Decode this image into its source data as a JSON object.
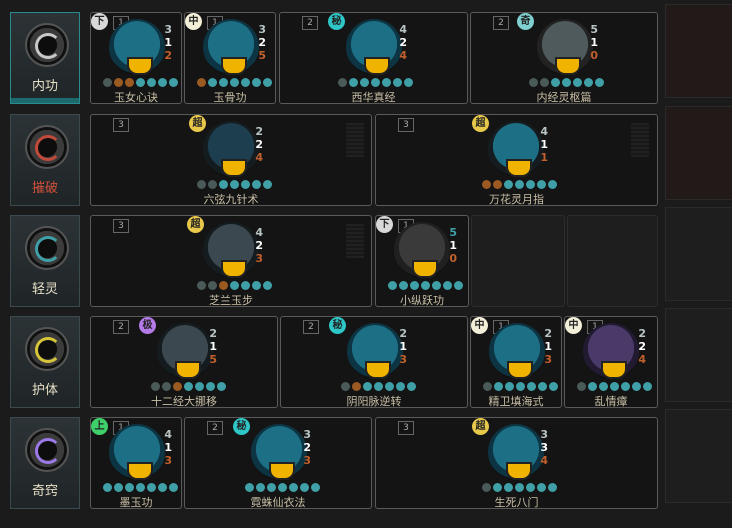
{
  "grade_colors": {
    "下": "#d8d8d8",
    "中": "#f3eed8",
    "秘": "#2ec6c6",
    "奇": "#7fd0d0",
    "超": "#e8c84a",
    "极": "#b47ae8",
    "上": "#3fcf6a"
  },
  "rows": [
    {
      "category": "内功",
      "emblem_color": "#c8c8c8",
      "skills": [
        {
          "grade": "下",
          "level": "1",
          "name": "玉女心诀",
          "v": [
            "3",
            "1",
            "2"
          ]
        },
        {
          "grade": "中",
          "level": "1",
          "name": "玉骨功",
          "v": [
            "3",
            "2",
            "5"
          ]
        },
        {
          "grade": "秘",
          "level": "2",
          "name": "西华真经",
          "v": [
            "4",
            "2",
            "4"
          ]
        },
        {
          "grade": "奇",
          "level": "2",
          "name": "内经灵枢篇",
          "v": [
            "5",
            "1",
            "0"
          ]
        }
      ]
    },
    {
      "category": "摧破",
      "emblem_color": "#c24a3a",
      "skills": [
        {
          "grade": "超",
          "level": "3",
          "name": "六弦九针术",
          "v": [
            "2",
            "2",
            "4"
          ]
        },
        {
          "grade": "超",
          "level": "3",
          "name": "万花灵月指",
          "v": [
            "4",
            "1",
            "1"
          ]
        }
      ]
    },
    {
      "category": "轻灵",
      "emblem_color": "#3fa0a8",
      "skills": [
        {
          "grade": "超",
          "level": "3",
          "name": "芝兰玉步",
          "v": [
            "4",
            "2",
            "3"
          ]
        },
        {
          "grade": "下",
          "level": "1",
          "name": "小纵跃功",
          "v": [
            "5",
            "1",
            "0"
          ]
        }
      ]
    },
    {
      "category": "护体",
      "emblem_color": "#d8c63a",
      "skills": [
        {
          "grade": "极",
          "level": "2",
          "name": "十二经大挪移",
          "v": [
            "2",
            "1",
            "5"
          ]
        },
        {
          "grade": "秘",
          "level": "2",
          "name": "阴阳脉逆转",
          "v": [
            "2",
            "1",
            "3"
          ]
        },
        {
          "grade": "中",
          "level": "1",
          "name": "精卫填海式",
          "v": [
            "2",
            "1",
            "3"
          ]
        },
        {
          "grade": "中",
          "level": "1",
          "name": "乱情瘴",
          "v": [
            "2",
            "2",
            "4"
          ]
        }
      ]
    },
    {
      "category": "奇窍",
      "emblem_color": "#9b7ae8",
      "skills": [
        {
          "grade": "上",
          "level": "1",
          "name": "墨玉功",
          "v": [
            "4",
            "1",
            "3"
          ]
        },
        {
          "grade": "秘",
          "level": "2",
          "name": "霓蛛仙衣法",
          "v": [
            "3",
            "2",
            "3"
          ]
        },
        {
          "grade": "超",
          "level": "3",
          "name": "生死八门",
          "v": [
            "3",
            "3",
            "4"
          ]
        }
      ]
    }
  ]
}
